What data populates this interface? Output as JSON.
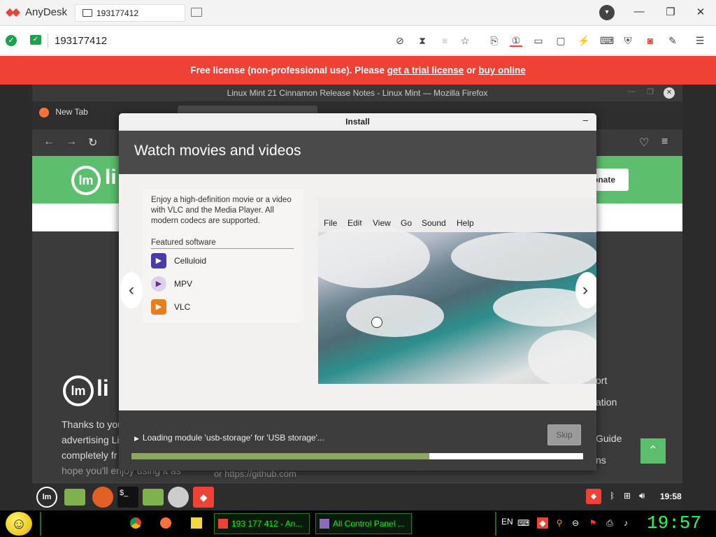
{
  "anydesk": {
    "app_name": "AnyDesk",
    "tab_label": "193177412",
    "address_value": "193177412",
    "banner": {
      "text_prefix": "Free license (non-professional use). Please",
      "trial_link": "get a trial license",
      "or": "or",
      "buy_link": "buy online"
    },
    "colors": {
      "accent": "#ef4136",
      "ok": "#1fa04a"
    }
  },
  "firefox": {
    "window_title": "Linux Mint 21 Cinnamon Release Notes - Linux Mint — Mozilla Firefox",
    "tab1": "New Tab"
  },
  "mint_page": {
    "donate_btn": "onate",
    "body_lines": [
      "Thanks to you",
      "advertising Li",
      "completely fr",
      "hope you'll enjoy using it as"
    ],
    "footer_link": "or https://github.com",
    "right_links": [
      "ort",
      "ation",
      "Guide",
      "ns"
    ]
  },
  "installer": {
    "title": "Install",
    "heading": "Watch movies and videos",
    "description": "Enjoy a high-definition movie or a video with VLC and the Media Player. All modern codecs are supported.",
    "featured_label": "Featured software",
    "apps": [
      {
        "name": "Celluloid",
        "color": "#4a3ca8"
      },
      {
        "name": "MPV",
        "color": "#6b2c8f"
      },
      {
        "name": "VLC",
        "color": "#e87e1e"
      }
    ],
    "player_menu": [
      "File",
      "Edit",
      "View",
      "Go",
      "Sound",
      "Help"
    ],
    "status": "Loading module 'usb-storage' for 'USB storage'...",
    "skip_label": "Skip",
    "progress": 0.66
  },
  "mint_panel": {
    "clock": "19:58"
  },
  "taskbar": {
    "buttons": [
      "193 177 412 - An...",
      "All Control Panel ..."
    ],
    "lang": "EN",
    "clock": "19:57"
  }
}
